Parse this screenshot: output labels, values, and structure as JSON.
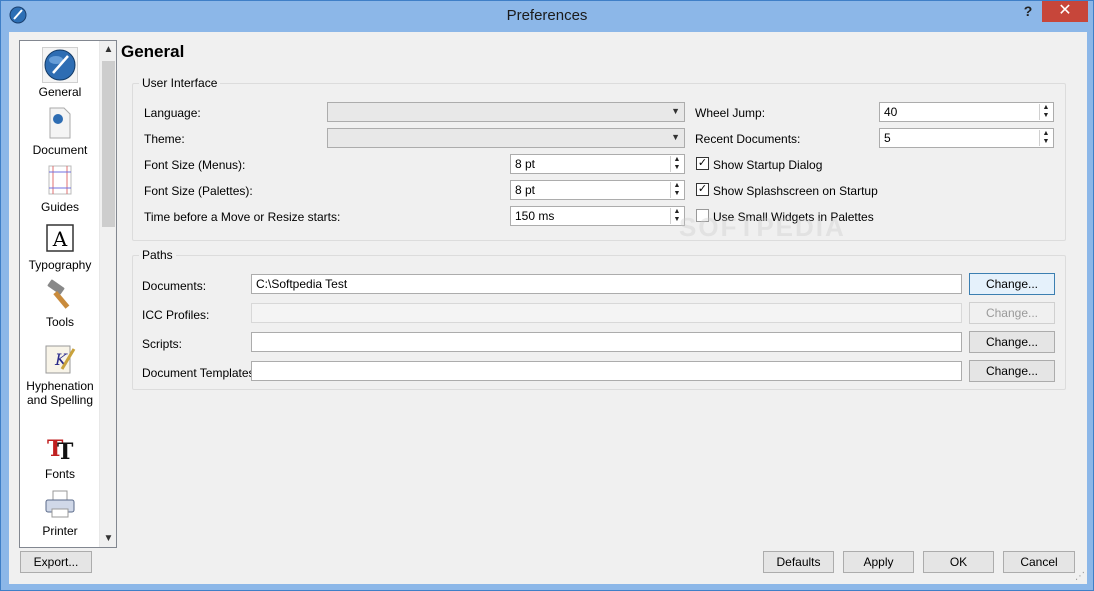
{
  "window": {
    "title": "Preferences",
    "help": "?",
    "close": "✕"
  },
  "sidebar": {
    "items": [
      {
        "label": "General",
        "icon": "scribus-logo-icon",
        "selected": true
      },
      {
        "label": "Document",
        "icon": "document-icon"
      },
      {
        "label": "Guides",
        "icon": "guides-icon"
      },
      {
        "label": "Typography",
        "icon": "typography-icon"
      },
      {
        "label": "Tools",
        "icon": "hammer-icon"
      },
      {
        "label": "Hyphenation and Spelling",
        "icon": "hyphenation-icon"
      },
      {
        "label": "Fonts",
        "icon": "fonts-icon"
      },
      {
        "label": "Printer",
        "icon": "printer-icon"
      }
    ]
  },
  "page_title": "General",
  "ui_group": {
    "title": "User Interface",
    "language_label": "Language:",
    "language_value": "",
    "theme_label": "Theme:",
    "theme_value": "",
    "font_menus_label": "Font Size (Menus):",
    "font_menus_value": "8 pt",
    "font_palettes_label": "Font Size (Palettes):",
    "font_palettes_value": "8 pt",
    "move_time_label": "Time before a Move or Resize starts:",
    "move_time_value": "150 ms",
    "wheel_jump_label": "Wheel Jump:",
    "wheel_jump_value": "40",
    "recent_docs_label": "Recent Documents:",
    "recent_docs_value": "5",
    "startup_dialog_label": "Show Startup Dialog",
    "startup_dialog_checked": true,
    "splash_label": "Show Splashscreen on Startup",
    "splash_checked": true,
    "small_widgets_label": "Use Small Widgets in Palettes",
    "small_widgets_checked": false
  },
  "paths_group": {
    "title": "Paths",
    "documents_label": "Documents:",
    "documents_value": "C:\\Softpedia Test",
    "icc_label": "ICC Profiles:",
    "icc_value": "",
    "scripts_label": "Scripts:",
    "scripts_value": "",
    "templates_label": "Document Templates:",
    "templates_value": "",
    "change_label": "Change..."
  },
  "footer": {
    "export": "Export...",
    "defaults": "Defaults",
    "apply": "Apply",
    "ok": "OK",
    "cancel": "Cancel"
  },
  "watermark": "SOFTPEDIA"
}
